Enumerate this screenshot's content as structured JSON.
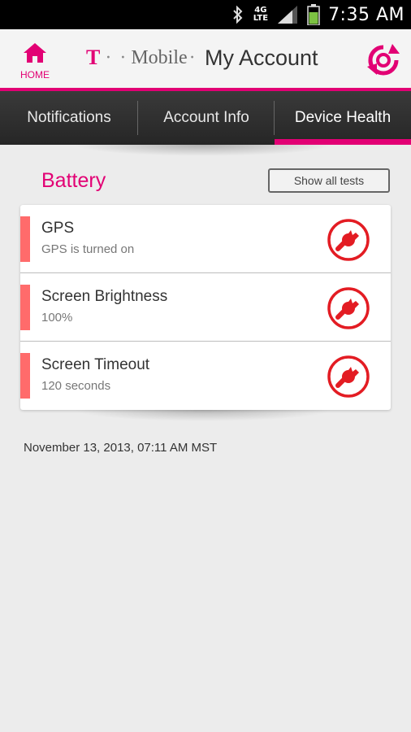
{
  "status_bar": {
    "network_type": "4G",
    "network_sub": "LTE",
    "time": "7:35 AM",
    "icons": [
      "bluetooth-icon",
      "signal-icon",
      "battery-icon"
    ]
  },
  "header": {
    "home_label": "HOME",
    "brand_t": "T",
    "brand_dots": "· ·",
    "brand_name": "Mobile",
    "brand_trail": "·",
    "title": "My Account",
    "accent_color": "#e20074"
  },
  "tabs": [
    {
      "label": "Notifications",
      "active": false
    },
    {
      "label": "Account Info",
      "active": false
    },
    {
      "label": "Device Health",
      "active": true
    }
  ],
  "section": {
    "title": "Battery",
    "show_all_label": "Show all tests"
  },
  "tests": [
    {
      "name": "GPS",
      "value": "GPS is turned on",
      "status_color": "#ff6b6b",
      "icon": "wrench-icon"
    },
    {
      "name": "Screen Brightness",
      "value": "100%",
      "status_color": "#ff6b6b",
      "icon": "wrench-icon"
    },
    {
      "name": "Screen Timeout",
      "value": "120 seconds",
      "status_color": "#ff6b6b",
      "icon": "wrench-icon"
    }
  ],
  "timestamp": "November 13, 2013, 07:11 AM MST"
}
